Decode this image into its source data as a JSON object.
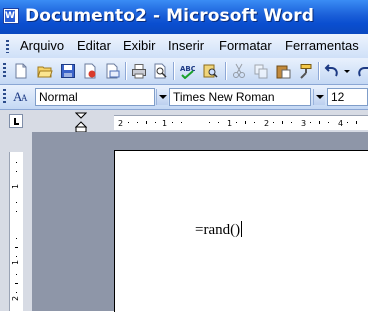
{
  "window": {
    "title": "Documento2 - Microsoft Word",
    "app_icon": "word-document-icon"
  },
  "menu": {
    "items": [
      {
        "label": "Arquivo"
      },
      {
        "label": "Editar"
      },
      {
        "label": "Exibir"
      },
      {
        "label": "Inserir"
      },
      {
        "label": "Formatar"
      },
      {
        "label": "Ferramentas"
      }
    ]
  },
  "standard_toolbar": {
    "buttons": [
      "new-icon",
      "open-icon",
      "save-icon",
      "permission-icon",
      "email-icon",
      "print-icon",
      "print-preview-icon",
      "spelling-icon",
      "research-icon",
      "cut-icon",
      "copy-icon",
      "paste-icon",
      "format-painter-icon",
      "undo-icon"
    ]
  },
  "formatting_toolbar": {
    "style": "Normal",
    "font": "Times New Roman",
    "size": "12"
  },
  "ruler": {
    "h_labels": [
      "2",
      "1",
      "1",
      "2",
      "3",
      "4"
    ],
    "v_labels": [
      "1",
      "1",
      "2"
    ]
  },
  "document": {
    "text": "=rand()"
  },
  "colors": {
    "titlebar": "#0a4ed0",
    "toolbar": "#c4d8f4",
    "workspace": "#8e96a8"
  }
}
